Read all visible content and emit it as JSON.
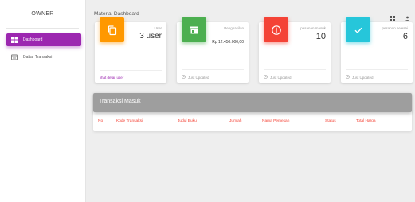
{
  "sidebar": {
    "brand": "OWNER",
    "items": [
      {
        "label": "Dashboard",
        "icon": "dashboard-icon",
        "active": true
      },
      {
        "label": "Daftar Transaksi",
        "icon": "receipt-icon",
        "active": false
      }
    ]
  },
  "topbar": {
    "title": "Material Dashboard",
    "icons": [
      "grid-icon",
      "person-icon"
    ]
  },
  "cards": [
    {
      "label": "User",
      "value": "3 user",
      "footer": "lihat detail user",
      "footer_link": true,
      "color": "#ff9800",
      "icon": "copy-icon"
    },
    {
      "label": "Penghasilan",
      "value": "Rp 12.450.000,00",
      "footer": "Just Updated",
      "footer_link": false,
      "color": "#4caf50",
      "icon": "store-icon"
    },
    {
      "label": "pesanan masuk",
      "value": "10",
      "footer": "Just Updated",
      "footer_link": false,
      "color": "#f44336",
      "icon": "info-icon"
    },
    {
      "label": "pesanan selesai",
      "value": "6",
      "footer": "Just Updated",
      "footer_link": false,
      "color": "#26c6da",
      "icon": "check-icon"
    }
  ],
  "panel": {
    "title": "Transaksi Masuk",
    "columns": [
      "No",
      "Kode Transaksi",
      "Judul Buku",
      "Jumlah",
      "Nama Pemesan",
      "Status",
      "Total Harga"
    ]
  },
  "colors": {
    "accent": "#9c27b0",
    "table_header": "#f44336",
    "panel_header": "#9e9e9e"
  }
}
